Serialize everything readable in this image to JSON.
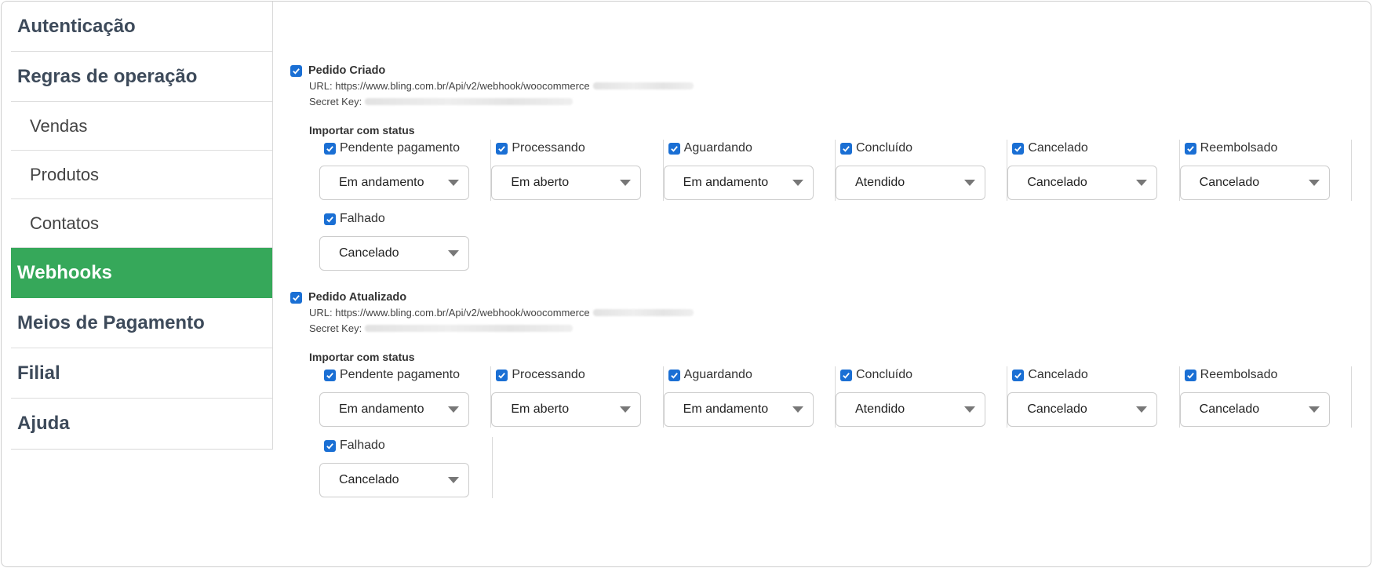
{
  "sidebar": {
    "items": [
      {
        "label": "Autenticação"
      },
      {
        "label": "Regras de operação"
      },
      {
        "label": "Vendas"
      },
      {
        "label": "Produtos"
      },
      {
        "label": "Contatos"
      },
      {
        "label": "Webhooks"
      },
      {
        "label": "Meios de Pagamento"
      },
      {
        "label": "Filial"
      },
      {
        "label": "Ajuda"
      }
    ]
  },
  "webhooks": [
    {
      "title": "Pedido Criado",
      "url_label": "URL:",
      "url_value": "https://www.bling.com.br/Api/v2/webhook/woocommerce",
      "secret_label": "Secret Key:",
      "import_label": "Importar com status",
      "statuses": [
        {
          "name": "Pendente pagamento",
          "value": "Em andamento"
        },
        {
          "name": "Processando",
          "value": "Em aberto"
        },
        {
          "name": "Aguardando",
          "value": "Em andamento"
        },
        {
          "name": "Concluído",
          "value": "Atendido"
        },
        {
          "name": "Cancelado",
          "value": "Cancelado"
        },
        {
          "name": "Reembolsado",
          "value": "Cancelado"
        },
        {
          "name": "Falhado",
          "value": "Cancelado"
        }
      ]
    },
    {
      "title": "Pedido Atualizado",
      "url_label": "URL:",
      "url_value": "https://www.bling.com.br/Api/v2/webhook/woocommerce",
      "secret_label": "Secret Key:",
      "import_label": "Importar com status",
      "statuses": [
        {
          "name": "Pendente pagamento",
          "value": "Em andamento"
        },
        {
          "name": "Processando",
          "value": "Em aberto"
        },
        {
          "name": "Aguardando",
          "value": "Em andamento"
        },
        {
          "name": "Concluído",
          "value": "Atendido"
        },
        {
          "name": "Cancelado",
          "value": "Cancelado"
        },
        {
          "name": "Reembolsado",
          "value": "Cancelado"
        },
        {
          "name": "Falhado",
          "value": "Cancelado"
        }
      ]
    }
  ],
  "colors": {
    "active_nav": "#36a85a",
    "checkbox": "#1a6fd4"
  },
  "icons": {
    "checkbox": "checkbox-checked-icon",
    "dropdown": "chevron-down-icon"
  }
}
